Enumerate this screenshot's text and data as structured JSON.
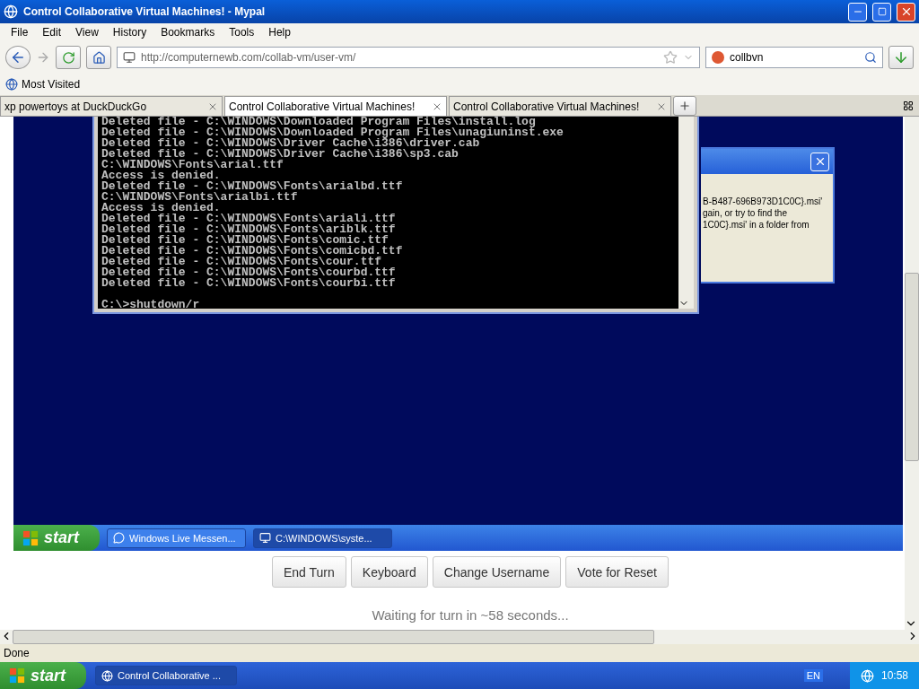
{
  "window": {
    "title": "Control Collaborative Virtual Machines! - Mypal"
  },
  "menu": [
    "File",
    "Edit",
    "View",
    "History",
    "Bookmarks",
    "Tools",
    "Help"
  ],
  "address": {
    "url": "http://computernewb.com/collab-vm/user-vm/"
  },
  "search": {
    "value": "collbvn"
  },
  "bookmarks": [
    "Most Visited"
  ],
  "tabs": [
    {
      "label": "xp powertoys at DuckDuckGo",
      "selected": false
    },
    {
      "label": "Control Collaborative Virtual Machines!",
      "selected": true
    },
    {
      "label": "Control Collaborative Virtual Machines!",
      "selected": false
    }
  ],
  "vm": {
    "console": {
      "lines": [
        "Deleted file - C:\\WINDOWS\\Downloaded Program Files\\install.log",
        "Deleted file - C:\\WINDOWS\\Downloaded Program Files\\unagiuninst.exe",
        "Deleted file - C:\\WINDOWS\\Driver Cache\\i386\\driver.cab",
        "Deleted file - C:\\WINDOWS\\Driver Cache\\i386\\sp3.cab",
        "C:\\WINDOWS\\Fonts\\arial.ttf",
        "Access is denied.",
        "Deleted file - C:\\WINDOWS\\Fonts\\arialbd.ttf",
        "C:\\WINDOWS\\Fonts\\arialbi.ttf",
        "Access is denied.",
        "Deleted file - C:\\WINDOWS\\Fonts\\ariali.ttf",
        "Deleted file - C:\\WINDOWS\\Fonts\\ariblk.ttf",
        "Deleted file - C:\\WINDOWS\\Fonts\\comic.ttf",
        "Deleted file - C:\\WINDOWS\\Fonts\\comicbd.ttf",
        "Deleted file - C:\\WINDOWS\\Fonts\\cour.ttf",
        "Deleted file - C:\\WINDOWS\\Fonts\\courbd.ttf",
        "Deleted file - C:\\WINDOWS\\Fonts\\courbi.ttf"
      ],
      "prompt": "C:\\>shutdown/r"
    },
    "dialog": {
      "lines": [
        "B-B487-696B973D1C0C}.msi'",
        "gain, or try to find the",
        "1C0C}.msi' in a folder from"
      ]
    },
    "taskbar": {
      "start": "start",
      "tasks": [
        {
          "label": "Windows Live Messen...",
          "selected": false
        },
        {
          "label": "C:\\WINDOWS\\syste...",
          "selected": true
        }
      ]
    }
  },
  "controls": [
    "End Turn",
    "Keyboard",
    "Change Username",
    "Vote for Reset"
  ],
  "turn_status": "Waiting for turn in ~58 seconds...",
  "status_bar": "Done",
  "os_taskbar": {
    "start": "start",
    "tasks": [
      {
        "label": "Control Collaborative ...",
        "selected": true
      }
    ],
    "language": "EN",
    "clock": "10:58"
  }
}
